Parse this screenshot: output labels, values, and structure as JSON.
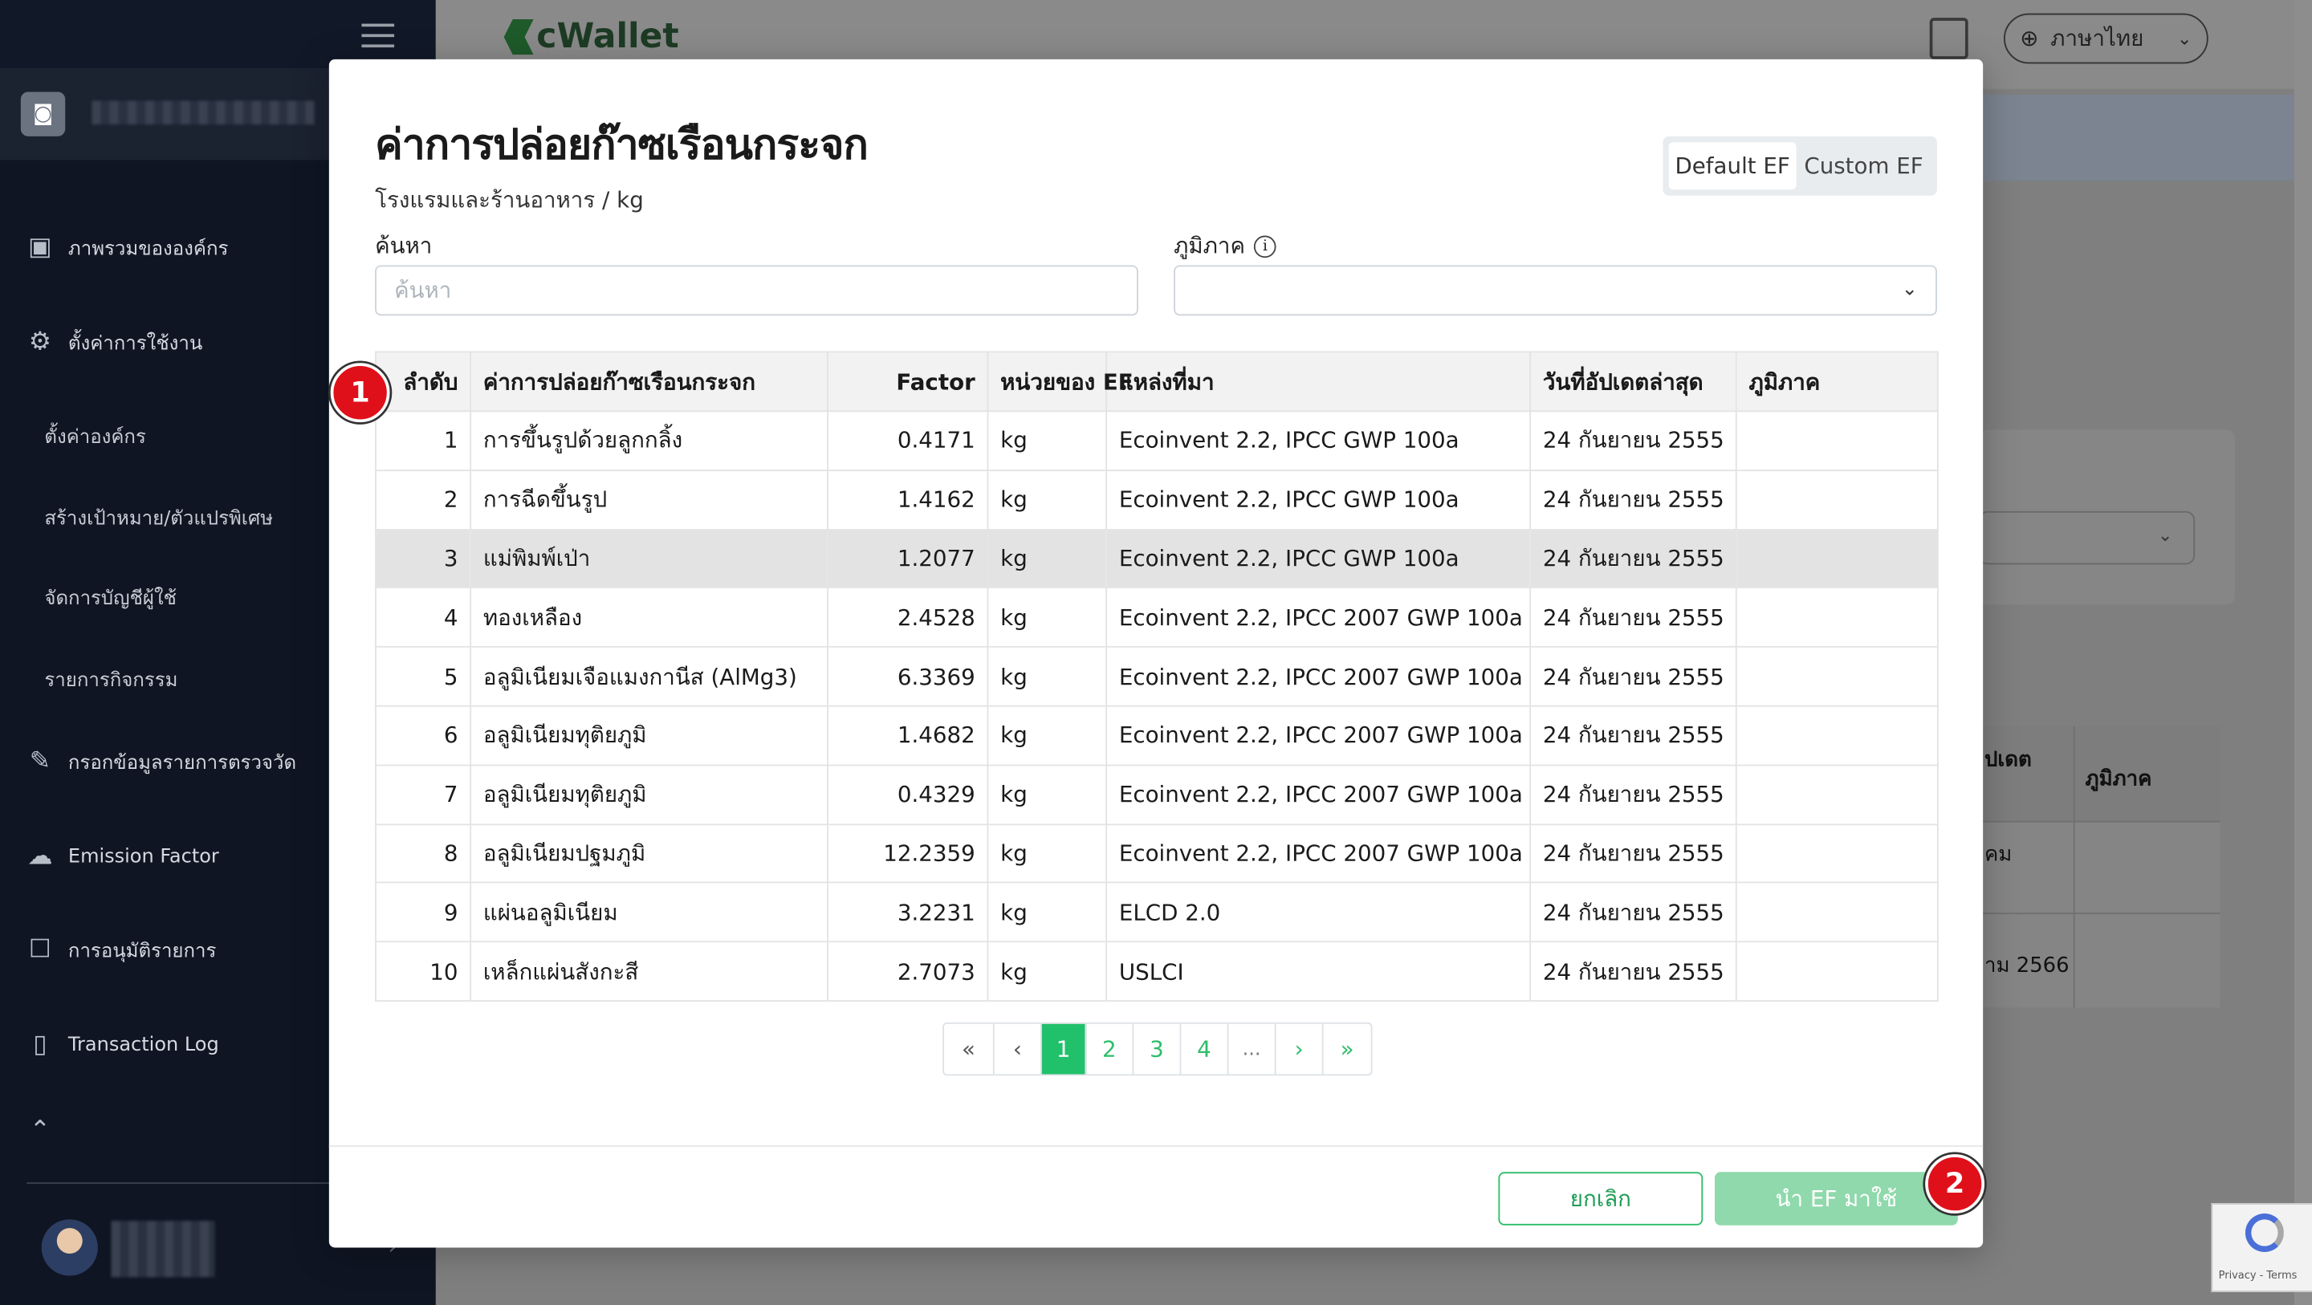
{
  "app": {
    "logo_text": "cWallet",
    "language": "ภาษาไทย"
  },
  "sidebar": {
    "items": [
      {
        "label": "ภาพรวมขององค์กร",
        "icon": "layout-icon"
      },
      {
        "label": "ตั้งค่าการใช้งาน",
        "icon": "gear-icon"
      },
      {
        "label": "ตั้งค่าองค์กร"
      },
      {
        "label": "สร้างเป้าหมาย/ตัวแปรพิเศษ"
      },
      {
        "label": "จัดการบัญชีผู้ใช้"
      },
      {
        "label": "รายการกิจกรรม"
      },
      {
        "label": "กรอกข้อมูลรายการตรวจวัด",
        "icon": "pencil-icon"
      },
      {
        "label": "Emission Factor",
        "icon": "cloud-icon"
      },
      {
        "label": "การอนุมัติรายการ",
        "icon": "approval-icon"
      },
      {
        "label": "Transaction Log",
        "icon": "clipboard-icon"
      }
    ]
  },
  "background": {
    "table_headers": [
      "ปเดต",
      "ภูมิภาค"
    ],
    "cells": [
      "คม",
      "าม 2566"
    ],
    "recaptcha_text": "Privacy - Terms"
  },
  "modal": {
    "title": "ค่าการปล่อยก๊าซเรือนกระจก",
    "subtitle": "โรงแรมและร้านอาหาร / kg",
    "toggle": {
      "default": "Default EF",
      "custom": "Custom EF"
    },
    "search_label": "ค้นหา",
    "search_placeholder": "ค้นหา",
    "region_label": "ภูมิภาค",
    "table": {
      "headers": [
        "ลำดับ",
        "ค่าการปล่อยก๊าซเรือนกระจก",
        "Factor",
        "หน่วยของ EF",
        "แหล่งที่มา",
        "วันที่อัปเดตล่าสุด",
        "ภูมิภาค"
      ],
      "rows": [
        [
          "1",
          "การขึ้นรูปด้วยลูกกลิ้ง",
          "0.4171",
          "kg",
          "Ecoinvent 2.2, IPCC GWP 100a",
          "24 กันยายน 2555",
          ""
        ],
        [
          "2",
          "การฉีดขึ้นรูป",
          "1.4162",
          "kg",
          "Ecoinvent 2.2, IPCC GWP 100a",
          "24 กันยายน 2555",
          ""
        ],
        [
          "3",
          "แม่พิมพ์เป่า",
          "1.2077",
          "kg",
          "Ecoinvent 2.2, IPCC GWP 100a",
          "24 กันยายน 2555",
          ""
        ],
        [
          "4",
          "ทองเหลือง",
          "2.4528",
          "kg",
          "Ecoinvent 2.2, IPCC 2007 GWP 100a",
          "24 กันยายน 2555",
          ""
        ],
        [
          "5",
          "อลูมิเนียมเจือแมงกานีส (AlMg3)",
          "6.3369",
          "kg",
          "Ecoinvent 2.2, IPCC 2007 GWP 100a",
          "24 กันยายน 2555",
          ""
        ],
        [
          "6",
          "อลูมิเนียมทุติยภูมิ",
          "1.4682",
          "kg",
          "Ecoinvent 2.2, IPCC 2007 GWP 100a",
          "24 กันยายน 2555",
          ""
        ],
        [
          "7",
          "อลูมิเนียมทุติยภูมิ",
          "0.4329",
          "kg",
          "Ecoinvent 2.2, IPCC 2007 GWP 100a",
          "24 กันยายน 2555",
          ""
        ],
        [
          "8",
          "อลูมิเนียมปฐมภูมิ",
          "12.2359",
          "kg",
          "Ecoinvent 2.2, IPCC 2007 GWP 100a",
          "24 กันยายน 2555",
          ""
        ],
        [
          "9",
          "แผ่นอลูมิเนียม",
          "3.2231",
          "kg",
          "ELCD 2.0",
          "24 กันยายน 2555",
          ""
        ],
        [
          "10",
          "เหล็กแผ่นสังกะสี",
          "2.7073",
          "kg",
          "USLCI",
          "24 กันยายน 2555",
          ""
        ]
      ],
      "highlighted_row": 3
    },
    "pagination": {
      "first": "«",
      "prev": "‹",
      "pages": [
        "1",
        "2",
        "3",
        "4"
      ],
      "ellipsis": "...",
      "next": "›",
      "last": "»",
      "current": "1"
    },
    "cancel_label": "ยกเลิก",
    "apply_label": "นำ EF มาใช้"
  },
  "annotations": [
    "1",
    "2"
  ],
  "colors": {
    "accent": "#21c06b",
    "badge": "#e0101a",
    "sidebar": "#0f1523"
  }
}
